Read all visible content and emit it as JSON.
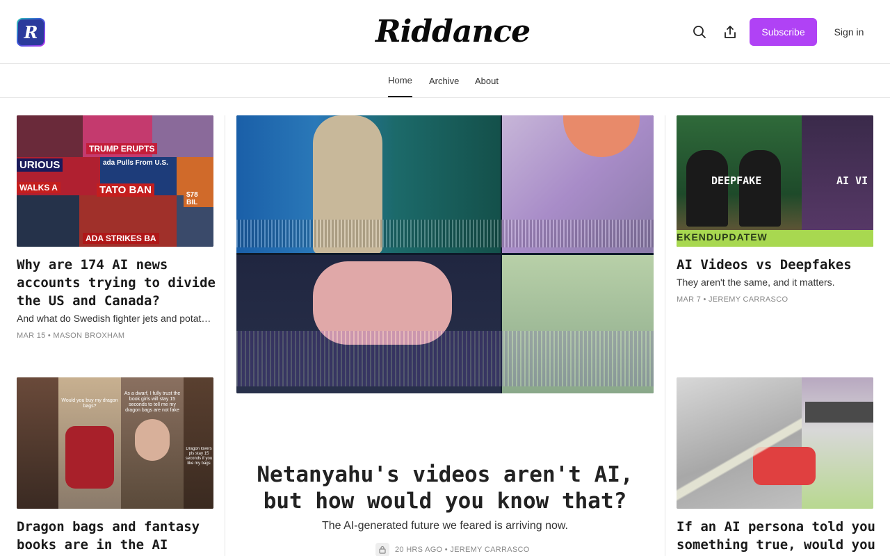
{
  "header": {
    "logo_letter": "R",
    "brand": "Riddance",
    "subscribe_label": "Subscribe",
    "signin_label": "Sign in"
  },
  "nav": {
    "items": [
      {
        "label": "Home",
        "active": true
      },
      {
        "label": "Archive",
        "active": false
      },
      {
        "label": "About",
        "active": false
      }
    ]
  },
  "posts": {
    "left_top": {
      "title": "Why are 174 AI news accounts trying to divide the US and Canada?",
      "subtitle": "And what do Swedish fighter jets and potatoes have to do with it?",
      "meta": "MAR 15 • MASON BROXHAM",
      "thumb_labels": [
        "TRUMP ERUPTS",
        "URIOUS",
        "WALKS A",
        "TATO BAN",
        "ADA STRIKES BA",
        "ada Pulls From U.S.",
        "$78 BIL"
      ]
    },
    "hero": {
      "title": "Netanyahu's videos aren't AI, but how would you know that?",
      "subtitle": "The AI-generated future we feared is arriving now.",
      "meta": "20 HRS AGO • JEREMY CARRASCO"
    },
    "right_top": {
      "title": "AI Videos vs Deepfakes",
      "subtitle": "They aren't the same, and it matters.",
      "meta": "MAR 7 • JEREMY CARRASCO",
      "thumb_labels": [
        "DEEPFAKE",
        "AI VI",
        "EKENDUPDATEW"
      ]
    },
    "left_bottom": {
      "title": "Dragon bags and fantasy books are in the AI",
      "thumb_captions": [
        "Would you buy my dragon bags?",
        "As a dwarf, I fully trust the book girls will stay 15 seconds to tell me my dragon bags are not fake",
        "Dragon lovers pls stay 15 seconds if you like my bags"
      ]
    },
    "right_bottom": {
      "title": "If an AI persona told you something true, would you"
    }
  },
  "colors": {
    "accent": "#b042f5",
    "text": "#1a1a1a",
    "muted": "#888888",
    "border": "#e6e6e6"
  },
  "icons": {
    "search": "search-icon",
    "share": "share-icon",
    "lock": "lock-icon"
  }
}
